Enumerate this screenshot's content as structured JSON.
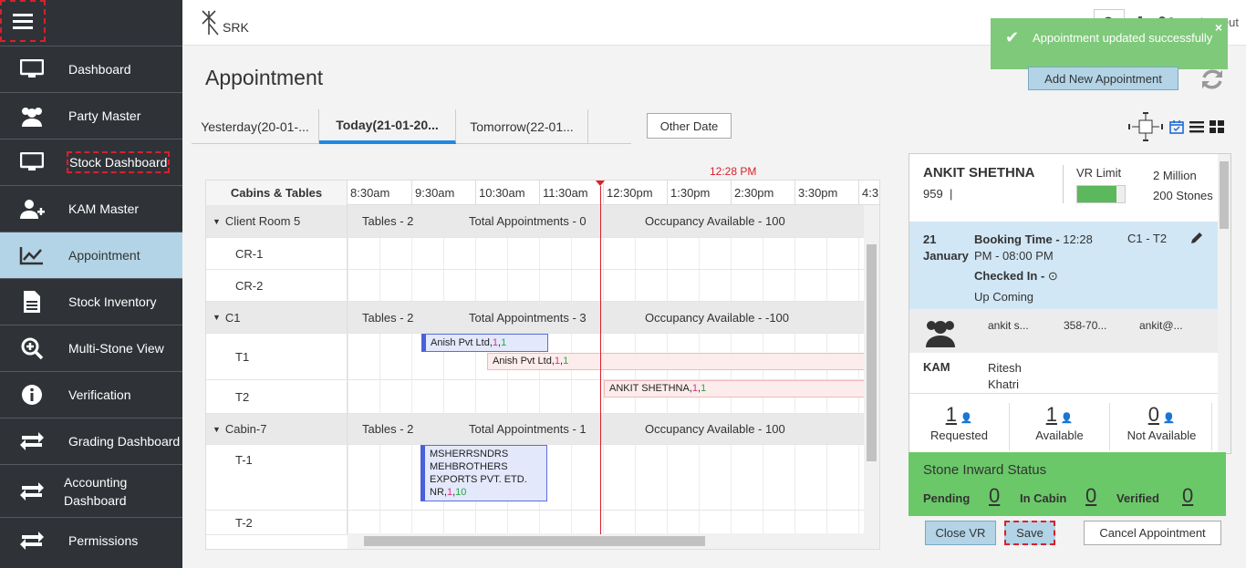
{
  "header": {
    "logo_text": "SRK",
    "notification_count": "3",
    "signout_label": "Sign Out"
  },
  "toast": {
    "message": "Appointment updated successfully"
  },
  "sidebar": {
    "items": [
      {
        "label": "Dashboard",
        "icon": "monitor-icon"
      },
      {
        "label": "Party Master",
        "icon": "users-icon"
      },
      {
        "label": "Stock Dashboard",
        "icon": "monitor-icon"
      },
      {
        "label": "KAM Master",
        "icon": "user-plus-icon"
      },
      {
        "label": "Appointment",
        "icon": "chart-line-icon",
        "active": true
      },
      {
        "label": "Stock Inventory",
        "icon": "document-icon"
      },
      {
        "label": "Multi-Stone View",
        "icon": "zoom-icon"
      },
      {
        "label": "Verification",
        "icon": "info-icon"
      },
      {
        "label": "Grading Dashboard",
        "icon": "exchange-icon"
      },
      {
        "label": "Accounting Dashboard",
        "icon": "exchange-icon"
      },
      {
        "label": "Permissions",
        "icon": "exchange-icon"
      }
    ]
  },
  "page": {
    "title": "Appointment",
    "add_button": "Add New Appointment",
    "tabs": [
      "Yesterday(20-01-...",
      "Today(21-01-20...",
      "Tomorrow(22-01..."
    ],
    "other_date": "Other Date"
  },
  "schedule": {
    "current_time": "12:28 PM",
    "header_label": "Cabins & Tables",
    "time_slots": [
      "8:30am",
      "9:30am",
      "10:30am",
      "11:30am",
      "12:30pm",
      "1:30pm",
      "2:30pm",
      "3:30pm",
      "4:3"
    ],
    "groups": [
      {
        "name": "Client Room 5",
        "tables": "Tables - 2",
        "total": "Total Appointments - 0",
        "occupancy": "Occupancy Available - 100",
        "rows": [
          "CR-1",
          "CR-2"
        ]
      },
      {
        "name": "C1",
        "tables": "Tables - 2",
        "total": "Total Appointments - 3",
        "occupancy": "Occupancy Available - -100",
        "rows": [
          "T1",
          "T2"
        ]
      },
      {
        "name": "Cabin-7",
        "tables": "Tables - 2",
        "total": "Total Appointments - 1",
        "occupancy": "Occupancy Available - 100",
        "rows": [
          "T-1",
          "T-2"
        ]
      }
    ],
    "appointments": [
      {
        "name": "Anish Pvt Ltd,",
        "a": "1",
        "b": "1"
      },
      {
        "name": "Anish Pvt Ltd,",
        "a": "1",
        "b": "1"
      },
      {
        "name": "ANKIT SHETHNA,",
        "a": "1",
        "b": "1"
      },
      {
        "name": "MSHERRSNDRS MEHBROTHERS EXPORTS PVT. ETD. NR,",
        "a": "1",
        "b": "10"
      }
    ]
  },
  "panel": {
    "client_name": "ANKIT SHETHNA",
    "client_id": "959",
    "client_id_sep": "|",
    "vr_label": "VR Limit",
    "vr_fill": 0.82,
    "limit": "2 Million",
    "stones": "200 Stones",
    "date": "21 January",
    "booking_label": "Booking Time -",
    "booking_time": "12:28 PM - 08:00 PM",
    "table": "C1 - T2",
    "checked_in": "Checked In -",
    "status": "Up Coming",
    "contact_name": "ankit s...",
    "contact_phone": "358-70...",
    "contact_email": "ankit@...",
    "kam_label": "KAM",
    "kam_value": "Ritesh Khatri",
    "stats": [
      {
        "n": "1",
        "label": "Requested"
      },
      {
        "n": "1",
        "label": "Available"
      },
      {
        "n": "0",
        "label": "Not Available"
      }
    ]
  },
  "inward": {
    "title": "Stone Inward Status",
    "pending_label": "Pending",
    "pending": "0",
    "incabin_label": "In Cabin",
    "incabin": "0",
    "verified_label": "Verified",
    "verified": "0"
  },
  "actions": {
    "close_vr": "Close VR",
    "save": "Save",
    "cancel": "Cancel Appointment"
  }
}
